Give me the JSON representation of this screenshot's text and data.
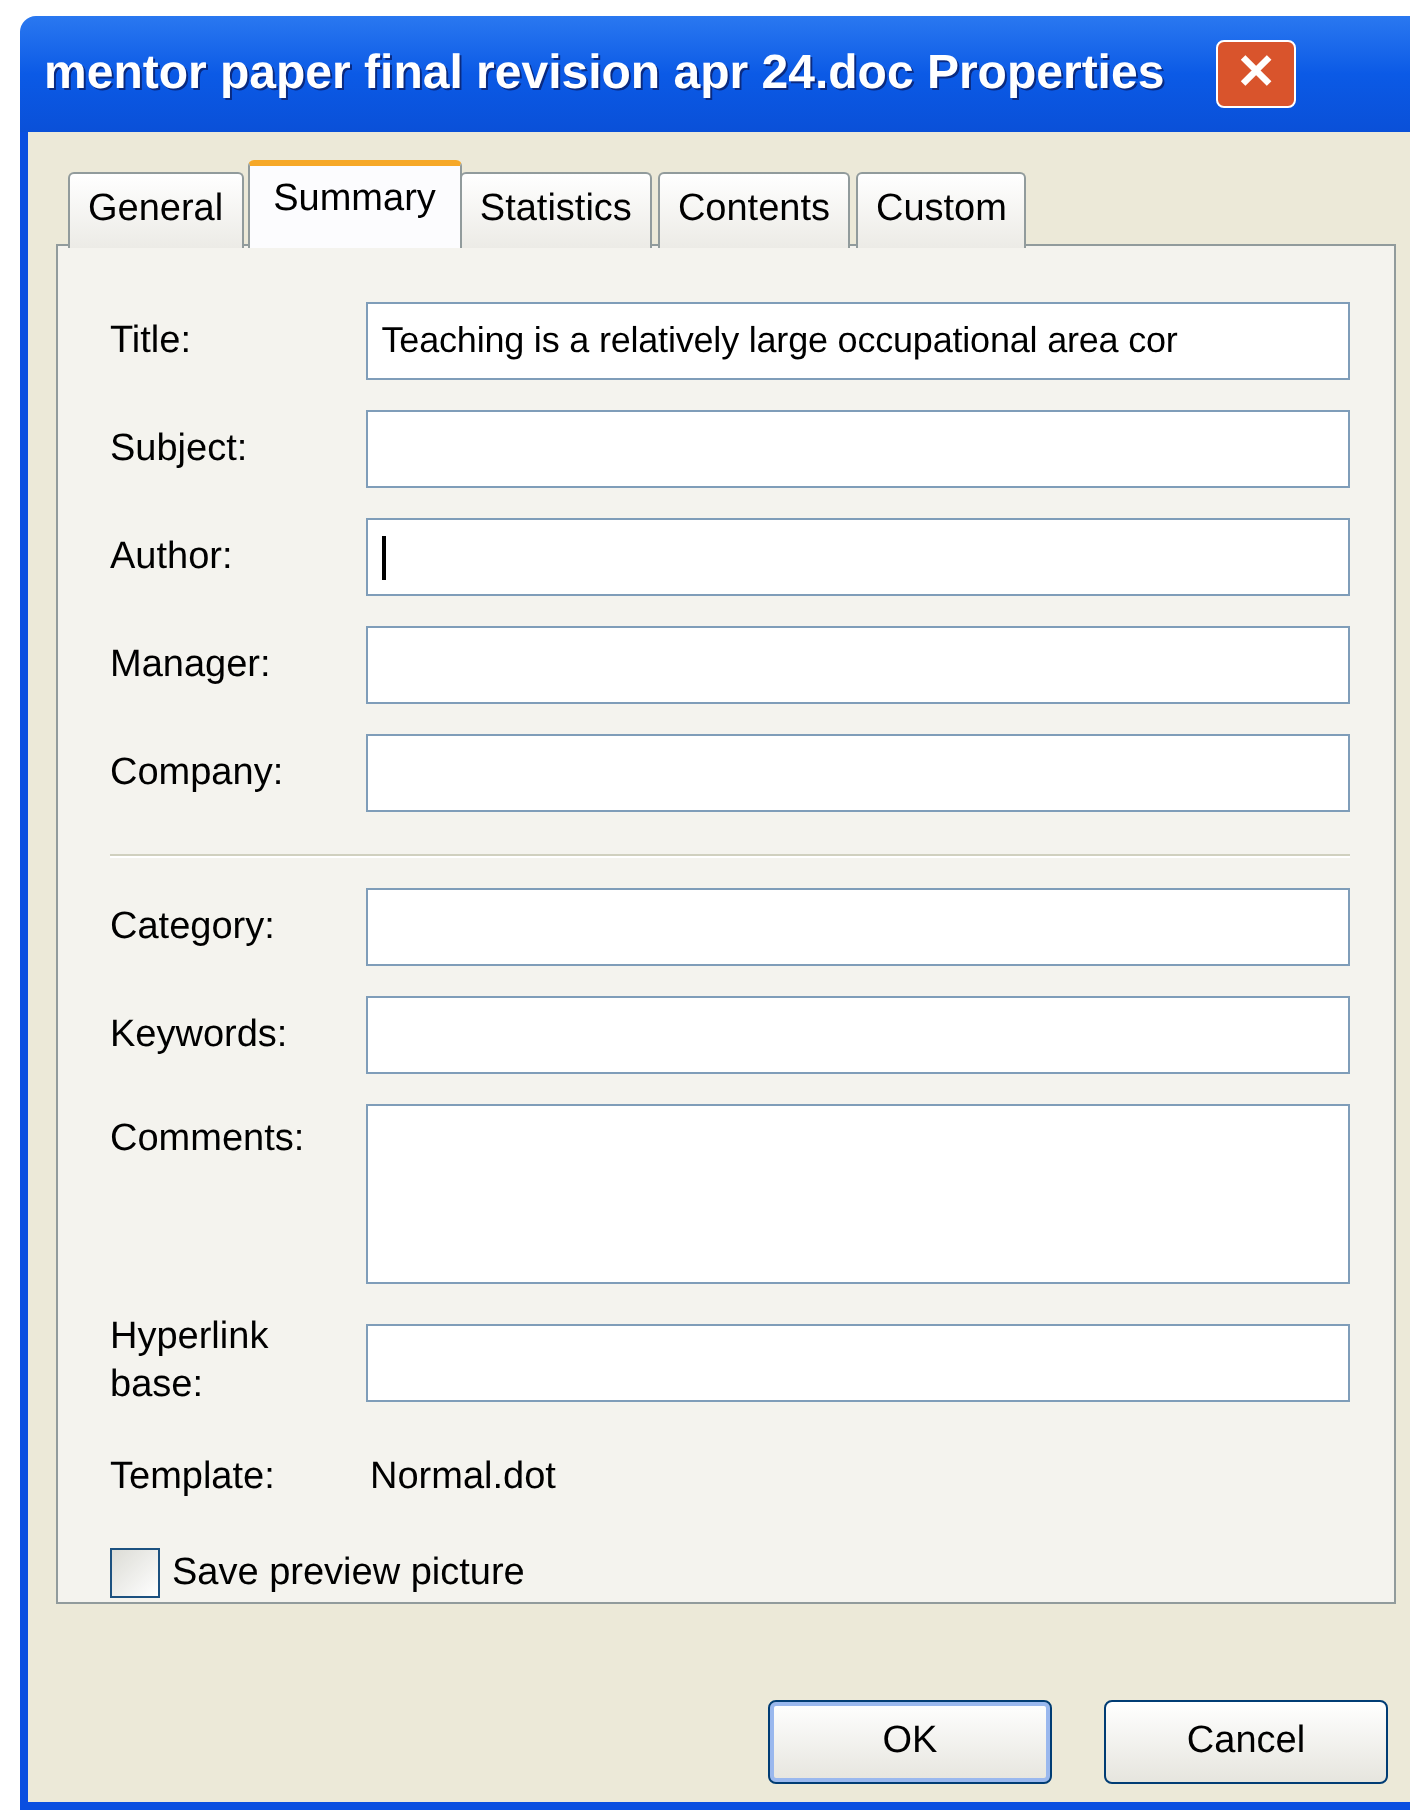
{
  "window": {
    "title": "mentor paper final revision apr 24.doc Properties",
    "close": "✕"
  },
  "tabs": [
    {
      "label": "General",
      "selected": false
    },
    {
      "label": "Summary",
      "selected": true
    },
    {
      "label": "Statistics",
      "selected": false
    },
    {
      "label": "Contents",
      "selected": false
    },
    {
      "label": "Custom",
      "selected": false
    }
  ],
  "field_groups": [
    [
      {
        "label": "Title:",
        "value": "Teaching is a relatively large occupational area cor",
        "kind": "line",
        "focused": false
      },
      {
        "label": "Subject:",
        "kind": "line",
        "focused": false
      },
      {
        "label": "Author:",
        "kind": "line",
        "focused": true
      },
      {
        "label": "Manager:",
        "kind": "line",
        "focused": false
      },
      {
        "label": "Company:",
        "kind": "line",
        "focused": false
      }
    ],
    [
      {
        "label": "Category:",
        "kind": "line",
        "focused": false
      },
      {
        "label": "Keywords:",
        "kind": "line",
        "focused": false
      },
      {
        "label": "Comments:",
        "kind": "multiline",
        "focused": false
      },
      {
        "label": "Hyperlink base:",
        "kind": "line",
        "focused": false
      }
    ]
  ],
  "template": {
    "label": "Template:",
    "value": "Normal.dot"
  },
  "save_preview": {
    "label": "Save preview picture",
    "checked": false
  },
  "buttons": [
    {
      "label": "OK",
      "default": true
    },
    {
      "label": "Cancel",
      "default": false
    }
  ]
}
